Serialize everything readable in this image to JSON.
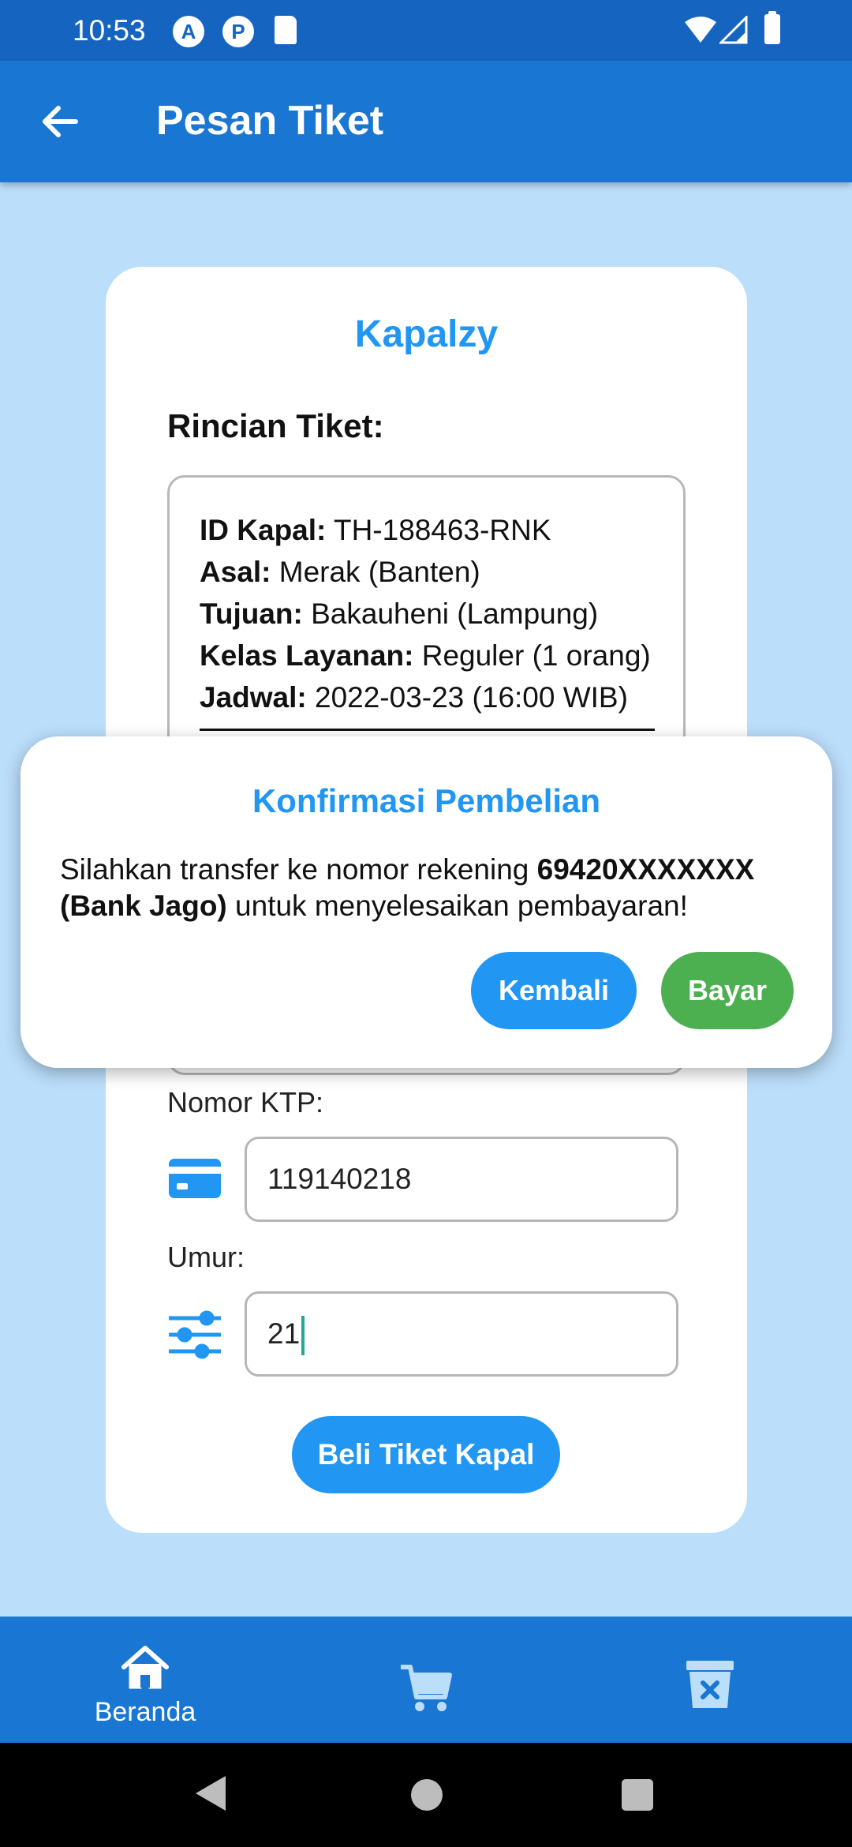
{
  "status_bar": {
    "time": "10:53",
    "left_icons": [
      "A",
      "P"
    ]
  },
  "app_bar": {
    "title": "Pesan Tiket",
    "back_icon": "arrow-left-icon"
  },
  "card": {
    "brand": "Kapalzy",
    "detail_title": "Rincian Tiket:",
    "details": [
      {
        "label": "ID Kapal:",
        "value": " TH-188463-RNK"
      },
      {
        "label": "Asal:",
        "value": " Merak (Banten)"
      },
      {
        "label": "Tujuan:",
        "value": " Bakauheni (Lampung)"
      },
      {
        "label": "Kelas Layanan:",
        "value": " Reguler (1 orang)"
      },
      {
        "label": "Jadwal:",
        "value": " 2022-03-23 (16:00 WIB)"
      }
    ],
    "ktp_label": "Nomor KTP:",
    "ktp_value": "119140218",
    "age_label": "Umur:",
    "age_value": "21",
    "buy_button": "Beli Tiket Kapal"
  },
  "dialog": {
    "title": "Konfirmasi Pembelian",
    "message_prefix": "Silahkan transfer ke nomor rekening ",
    "account": "69420XXXXXXX (Bank Jago)",
    "message_suffix": " untuk menyelesaikan pembayaran!",
    "cancel_label": "Kembali",
    "confirm_label": "Bayar",
    "colors": {
      "accent": "#2196f3",
      "confirm": "#4caf50"
    }
  },
  "bottom_nav": {
    "items": [
      {
        "label": "Beranda",
        "icon": "home-icon"
      },
      {
        "label": "",
        "icon": "cart-icon"
      },
      {
        "label": "",
        "icon": "trash-icon"
      }
    ]
  }
}
